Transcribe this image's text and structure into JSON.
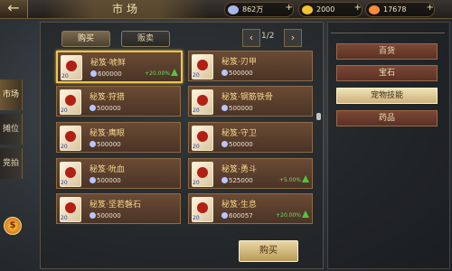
{
  "header": {
    "title": "市场",
    "back_icon": "←"
  },
  "currencies": [
    {
      "name": "silver",
      "value": "862万",
      "color": "#a8b8e6"
    },
    {
      "name": "gold",
      "value": "2000",
      "color": "#f1c232"
    },
    {
      "name": "ingot",
      "value": "17678",
      "color": "#ff8c3a"
    }
  ],
  "side_tabs": [
    "市场",
    "摊位",
    "竞拍"
  ],
  "tabs": {
    "buy": "购买",
    "sell": "贩卖"
  },
  "pagination": {
    "label": "1/2",
    "prev": "‹",
    "next": "›"
  },
  "items": [
    {
      "name": "秘笈·唬鲜",
      "price": "600000",
      "pct": "+20.00%",
      "level": "20"
    },
    {
      "name": "秘笈·刃甲",
      "price": "500000",
      "pct": "",
      "level": "20"
    },
    {
      "name": "秘笈·狩猎",
      "price": "500000",
      "pct": "",
      "level": "20"
    },
    {
      "name": "秘笈·钢筋铁骨",
      "price": "500000",
      "pct": "",
      "level": "20"
    },
    {
      "name": "秘笈·鹰眼",
      "price": "500000",
      "pct": "",
      "level": "20"
    },
    {
      "name": "秘笈·守卫",
      "price": "500000",
      "pct": "",
      "level": "20"
    },
    {
      "name": "秘笈·吮血",
      "price": "500000",
      "pct": "",
      "level": "20"
    },
    {
      "name": "秘笈·勇斗",
      "price": "525000",
      "pct": "+5.00%",
      "level": "20"
    },
    {
      "name": "秘笈·坚若磐石",
      "price": "500000",
      "pct": "",
      "level": "20"
    },
    {
      "name": "秘笈·生息",
      "price": "600057",
      "pct": "+20.00%",
      "level": "20"
    }
  ],
  "buy_button": "购买",
  "categories": [
    "百货",
    "宝石",
    "宠物技能",
    "药品"
  ],
  "active_category": "宠物技能",
  "coin_badge": "$"
}
